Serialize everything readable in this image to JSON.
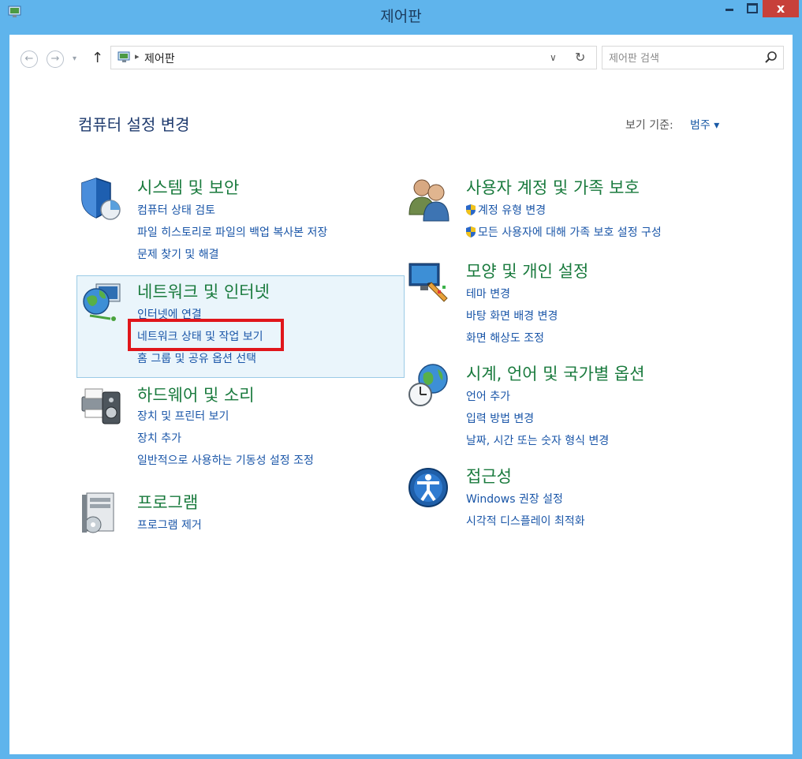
{
  "window": {
    "title": "제어판",
    "close_label": "x"
  },
  "address_bar": {
    "path": "제어판",
    "search_placeholder": "제어판 검색"
  },
  "header": {
    "heading": "컴퓨터 설정 변경",
    "view_by_label": "보기 기준:",
    "view_by_value": "범주 ▾"
  },
  "categories": {
    "system": {
      "title": "시스템 및 보안",
      "links": [
        "컴퓨터 상태 검토",
        "파일 히스토리로 파일의 백업 복사본 저장",
        "문제 찾기 및 해결"
      ]
    },
    "network": {
      "title": "네트워크 및 인터넷",
      "links": [
        "인터넷에 연결",
        "네트워크 상태 및 작업 보기",
        "홈 그룹 및 공유 옵션 선택"
      ]
    },
    "hardware": {
      "title": "하드웨어 및 소리",
      "links": [
        "장치 및 프린터 보기",
        "장치 추가",
        "일반적으로 사용하는 기동성 설정 조정"
      ]
    },
    "programs": {
      "title": "프로그램",
      "links": [
        "프로그램 제거"
      ]
    },
    "users": {
      "title": "사용자 계정 및 가족 보호",
      "links": [
        "계정 유형 변경",
        "모든 사용자에 대해 가족 보호 설정 구성"
      ]
    },
    "appearance": {
      "title": "모양 및 개인 설정",
      "links": [
        "테마 변경",
        "바탕 화면 배경 변경",
        "화면 해상도 조정"
      ]
    },
    "clock": {
      "title": "시계, 언어 및 국가별 옵션",
      "links": [
        "언어 추가",
        "입력 방법 변경",
        "날짜, 시간 또는 숫자 형식 변경"
      ]
    },
    "ease": {
      "title": "접근성",
      "links": [
        "Windows 권장 설정",
        "시각적 디스플레이 최적화"
      ]
    }
  },
  "colors": {
    "title_bar": "#5fb4ec",
    "category_title": "#197a3d",
    "link": "#1a56a8",
    "highlight": "#e0161b",
    "close_button": "#c7403a"
  }
}
